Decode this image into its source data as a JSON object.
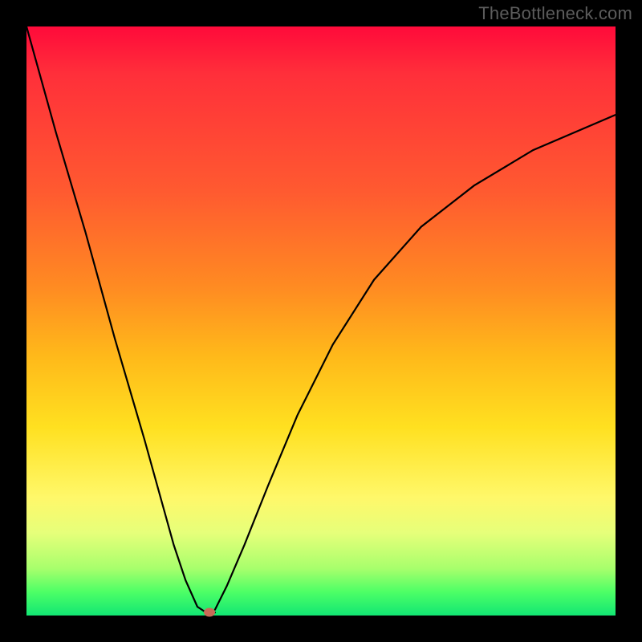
{
  "watermark": "TheBottleneck.com",
  "chart_data": {
    "type": "line",
    "title": "",
    "xlabel": "",
    "ylabel": "",
    "xlim": [
      0,
      100
    ],
    "ylim": [
      0,
      100
    ],
    "grid": false,
    "legend": false,
    "background": "red-to-green vertical gradient",
    "series": [
      {
        "name": "left-branch",
        "x": [
          0,
          5,
          10,
          15,
          20,
          25,
          27,
          29,
          30.5
        ],
        "y": [
          100,
          82,
          65,
          47,
          30,
          12,
          6,
          1.5,
          0.5
        ]
      },
      {
        "name": "right-branch",
        "x": [
          32,
          34,
          37,
          41,
          46,
          52,
          59,
          67,
          76,
          86,
          100
        ],
        "y": [
          1,
          5,
          12,
          22,
          34,
          46,
          57,
          66,
          73,
          79,
          85
        ]
      }
    ],
    "marker": {
      "name": "minimum-point",
      "x": 31,
      "y": 0.5,
      "color": "#c96a57"
    }
  }
}
